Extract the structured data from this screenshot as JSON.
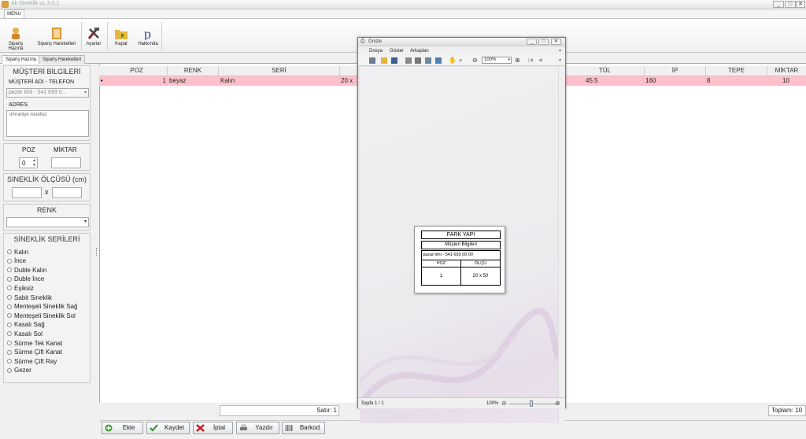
{
  "app": {
    "title": "Ak Sineklik v1.3.0.1"
  },
  "window_buttons": {
    "minimize": "_",
    "restore": "□",
    "close": "✕"
  },
  "menu_tab": "MENU",
  "ribbon": [
    {
      "label": "Sipariş Hazırla",
      "icon": "worker-icon"
    },
    {
      "label": "Sipariş Hareketleri",
      "icon": "book-icon"
    },
    {
      "label": "Ayarlar",
      "icon": "tools-icon"
    },
    {
      "label": "Kapat",
      "icon": "folder-exit-icon"
    },
    {
      "label": "Hakkında",
      "icon": "p-letter-icon"
    }
  ],
  "page_tabs": [
    "Sipariş Hazırla",
    "Sipariş Hareketleri"
  ],
  "customer": {
    "section_title": "MÜŞTERİ BİLGİLERİ",
    "name_label": "MÜŞTERİ ADI - TELEFON",
    "name_value": "pazar timi - 541 693 0...",
    "address_label": "ADRES",
    "address_value": "ümraniye istanbul"
  },
  "poz_miktar": {
    "poz_label": "POZ",
    "miktar_label": "MİKTAR",
    "poz_value": "0",
    "miktar_value": ""
  },
  "size": {
    "title": "SİNEKLİK ÖLÇÜSÜ (cm)",
    "times": "x",
    "width": "",
    "height": ""
  },
  "color": {
    "title": "RENK",
    "value": ""
  },
  "series": {
    "title": "SİNEKLİK SERİLERİ",
    "items": [
      "Kalın",
      "İnce",
      "Duble Kalın",
      "Duble İnce",
      "Eşiksiz",
      "Sabit Sineklik",
      "Menteşeli Sineklik Sağ",
      "Menteşeli Sineklik Sol",
      "Kasalı Sağ",
      "Kasalı Sol",
      "Sürme Tek Kanat",
      "Sürme Çift Kanat",
      "Sürme Çift Ray",
      "Gezer"
    ]
  },
  "grid": {
    "columns": [
      "POZ",
      "RENK",
      "SERİ",
      "TÜL",
      "İP",
      "TEPE",
      "MİKTAR"
    ],
    "rows": [
      {
        "indicator": "▸",
        "poz": "1",
        "renk": "beyaz",
        "seri": "Kalın",
        "olcu": "20 x",
        "tul": "45.5",
        "ip": "160",
        "tepe": "8",
        "miktar": "10"
      }
    ]
  },
  "status": {
    "rows": "Satır: 1",
    "total": "Toplam: 10"
  },
  "buttons": {
    "ekle": "Ekle",
    "kaydet": "Kaydet",
    "iptal": "İptal",
    "yazdir": "Yazdır",
    "barkod": "Barkod"
  },
  "preview": {
    "title": "Önizle",
    "menu": [
      "Dosya",
      "Göster",
      "Arkaplan"
    ],
    "zoom": "100%",
    "page_status": "Sayfa 1 / 1",
    "zoom_status": "100%",
    "report": {
      "company": "FARK YAPI",
      "section": "Müşteri Bilgileri",
      "customer": "pazar timi - 541 693 00 00",
      "col_poz": "POZ",
      "col_olcu": "ÖLÇÜ",
      "poz": "1",
      "olcu": "20 x 50"
    }
  },
  "colors": {
    "row_highlight": "#ffc0cb",
    "accent": "#3a5f95"
  }
}
